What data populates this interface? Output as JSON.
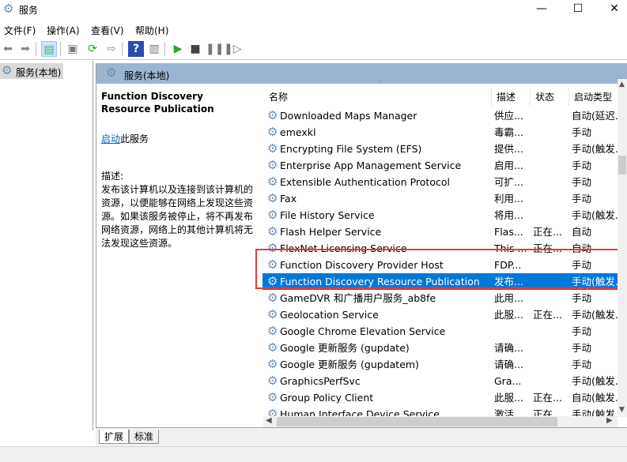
{
  "window": {
    "title": "服务",
    "minimize": "—",
    "maximize": "☐",
    "close": "✕"
  },
  "menu": [
    "文件(F)",
    "操作(A)",
    "查看(V)",
    "帮助(H)"
  ],
  "toolbar": [
    "back-icon",
    "forward-icon",
    "show-hide-console-tree-icon",
    "properties-icon",
    "refresh-icon",
    "export-list-icon",
    "help-icon",
    "show-action-pane-icon",
    "start-service-icon",
    "stop-service-icon",
    "pause-service-icon",
    "resume-service-icon"
  ],
  "tree": {
    "root": "服务(本地)"
  },
  "panel": {
    "header": "服务(本地)"
  },
  "details": {
    "service_name": "Function Discovery Resource Publication",
    "start_link": "启动",
    "start_suffix": "此服务",
    "desc_label": "描述:",
    "desc_text": "发布该计算机以及连接到该计算机的资源，以便能够在网络上发现这些资源。如果该服务被停止，将不再发布网络资源，网络上的其他计算机将无法发现这些资源。"
  },
  "columns": [
    "名称",
    "描述",
    "状态",
    "启动类型"
  ],
  "rows": [
    {
      "name": "Downloaded Maps Manager",
      "desc": "供应...",
      "status": "",
      "startup": "自动(延迟..."
    },
    {
      "name": "emexkl",
      "desc": "毒霸...",
      "status": "",
      "startup": "手动"
    },
    {
      "name": "Encrypting File System (EFS)",
      "desc": "提供...",
      "status": "",
      "startup": "手动(触发..."
    },
    {
      "name": "Enterprise App Management Service",
      "desc": "启用...",
      "status": "",
      "startup": "手动"
    },
    {
      "name": "Extensible Authentication Protocol",
      "desc": "可扩...",
      "status": "",
      "startup": "手动"
    },
    {
      "name": "Fax",
      "desc": "利用...",
      "status": "",
      "startup": "手动"
    },
    {
      "name": "File History Service",
      "desc": "将用...",
      "status": "",
      "startup": "手动(触发..."
    },
    {
      "name": "Flash Helper Service",
      "desc": "Flas...",
      "status": "正在...",
      "startup": "自动"
    },
    {
      "name": "FlexNet Licensing Service",
      "desc": "This ...",
      "status": "正在...",
      "startup": "自动"
    },
    {
      "name": "Function Discovery Provider Host",
      "desc": "FDP...",
      "status": "",
      "startup": "手动"
    },
    {
      "name": "Function Discovery Resource Publication",
      "desc": "发布...",
      "status": "",
      "startup": "手动(触发..."
    },
    {
      "name": "GameDVR 和广播用户服务_ab8fe",
      "desc": "此用...",
      "status": "",
      "startup": "手动"
    },
    {
      "name": "Geolocation Service",
      "desc": "此服...",
      "status": "正在...",
      "startup": "手动(触发..."
    },
    {
      "name": "Google Chrome Elevation Service",
      "desc": "",
      "status": "",
      "startup": "手动"
    },
    {
      "name": "Google 更新服务 (gupdate)",
      "desc": "请确...",
      "status": "",
      "startup": "手动"
    },
    {
      "name": "Google 更新服务 (gupdatem)",
      "desc": "请确...",
      "status": "",
      "startup": "手动"
    },
    {
      "name": "GraphicsPerfSvc",
      "desc": "Gra...",
      "status": "",
      "startup": "手动(触发..."
    },
    {
      "name": "Group Policy Client",
      "desc": "此服...",
      "status": "正在...",
      "startup": "自动(触发..."
    },
    {
      "name": "Human Interface Device Service",
      "desc": "激活...",
      "status": "正在...",
      "startup": "手动(触发..."
    }
  ],
  "selected_index": 10,
  "tabs": [
    "扩展",
    "标准"
  ],
  "colors": {
    "selection": "#0078d7",
    "highlight_box": "#e8393b",
    "panel_header": "#9bb4d1",
    "link": "#0066cc"
  }
}
